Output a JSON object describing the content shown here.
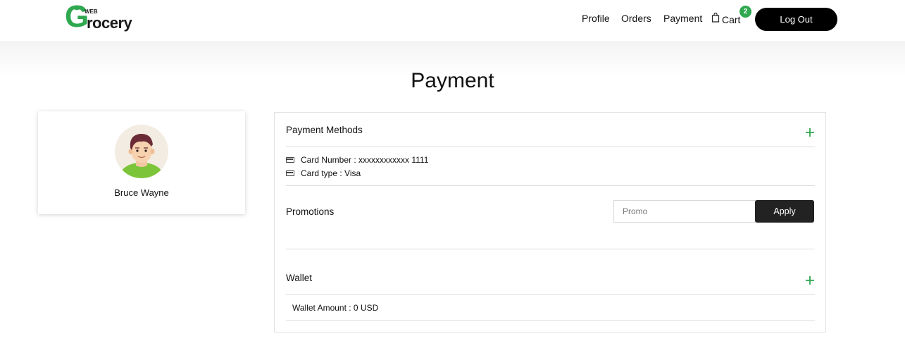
{
  "brand": {
    "web": "WEB",
    "initial": "G",
    "rest": "rocery",
    "color": "#2fa84f"
  },
  "nav": {
    "profile": "Profile",
    "orders": "Orders",
    "payment": "Payment",
    "cart": "Cart",
    "cart_count": "2",
    "logout": "Log Out"
  },
  "page": {
    "title": "Payment"
  },
  "profile": {
    "name": "Bruce Wayne"
  },
  "payment_methods": {
    "title": "Payment Methods",
    "card_number": "Card Number : xxxxxxxxxxxx 1111",
    "card_type": "Card type : Visa"
  },
  "promotions": {
    "title": "Promotions",
    "placeholder": "Promo",
    "value": "",
    "apply_label": "Apply"
  },
  "wallet": {
    "title": "Wallet",
    "amount": "Wallet Amount : 0 USD"
  },
  "colors": {
    "accent": "#2fa84f",
    "dark": "#222222",
    "button_black": "#000000"
  }
}
